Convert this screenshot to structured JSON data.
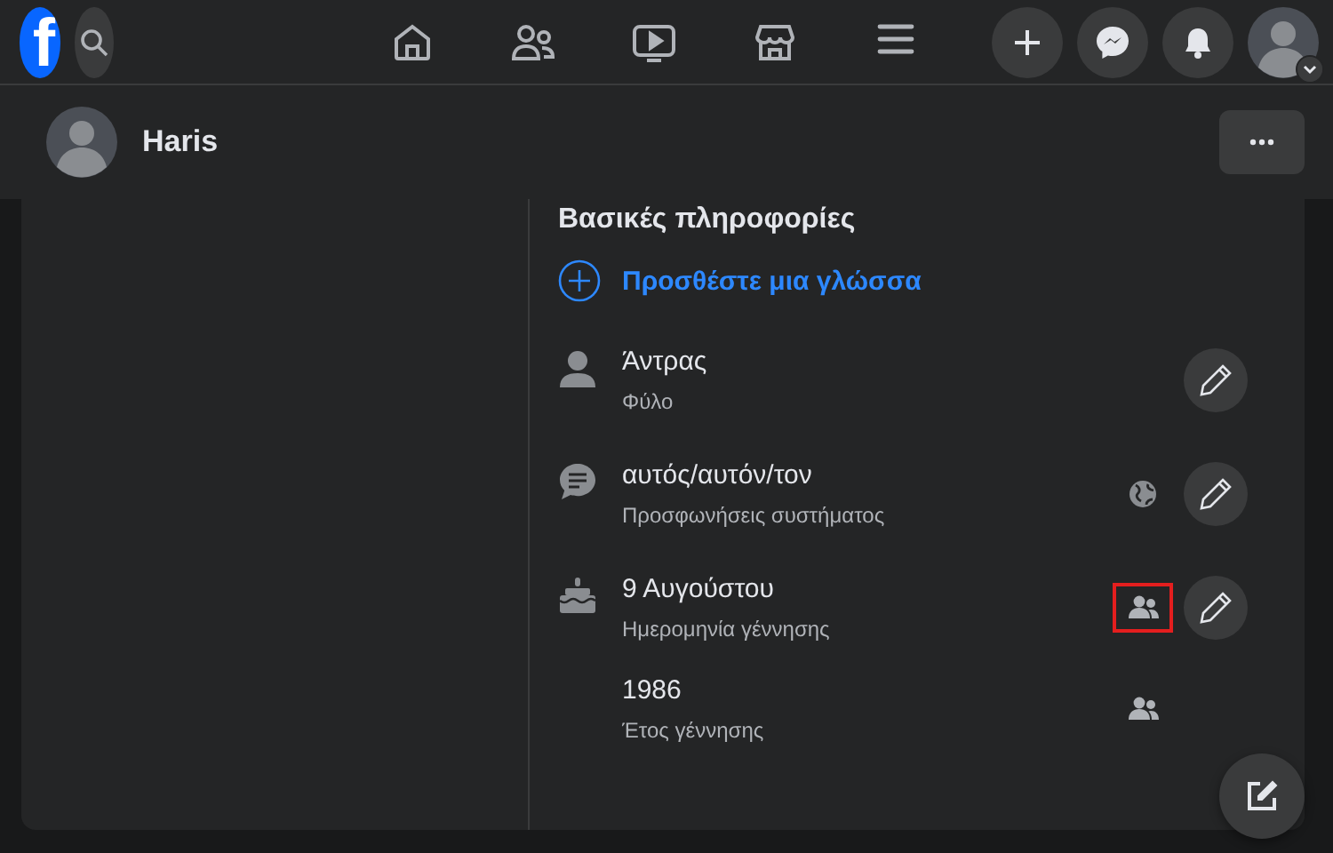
{
  "topbar": {
    "logo": "f",
    "nav": [
      {
        "kind": "home"
      },
      {
        "kind": "friends"
      },
      {
        "kind": "watch"
      },
      {
        "kind": "marketplace"
      },
      {
        "kind": "menu"
      }
    ],
    "actions": [
      {
        "kind": "plus"
      },
      {
        "kind": "messenger"
      },
      {
        "kind": "bell"
      }
    ]
  },
  "profile": {
    "name": "Haris"
  },
  "section": {
    "heading": "Βασικές πληροφορίες",
    "add_link": "Προσθέστε μια γλώσσα",
    "items": [
      {
        "kind": "person",
        "value": "Άντρας",
        "label": "Φύλο",
        "editable": true
      },
      {
        "kind": "chat",
        "value": "αυτός/αυτόν/τον",
        "label": "Προσφωνήσεις συστήματος",
        "audience": {
          "kind": "public"
        },
        "editable": true
      },
      {
        "kind": "cake",
        "value": "9 Αυγούστου",
        "label": "Ημερομηνία γέννησης",
        "audience": {
          "kind": "friends"
        },
        "highlighted": true,
        "editable": true
      },
      {
        "kind": "plain",
        "value": "1986",
        "label": "Έτος γέννησης",
        "audience": {
          "kind": "friends"
        },
        "editable": false
      }
    ]
  }
}
